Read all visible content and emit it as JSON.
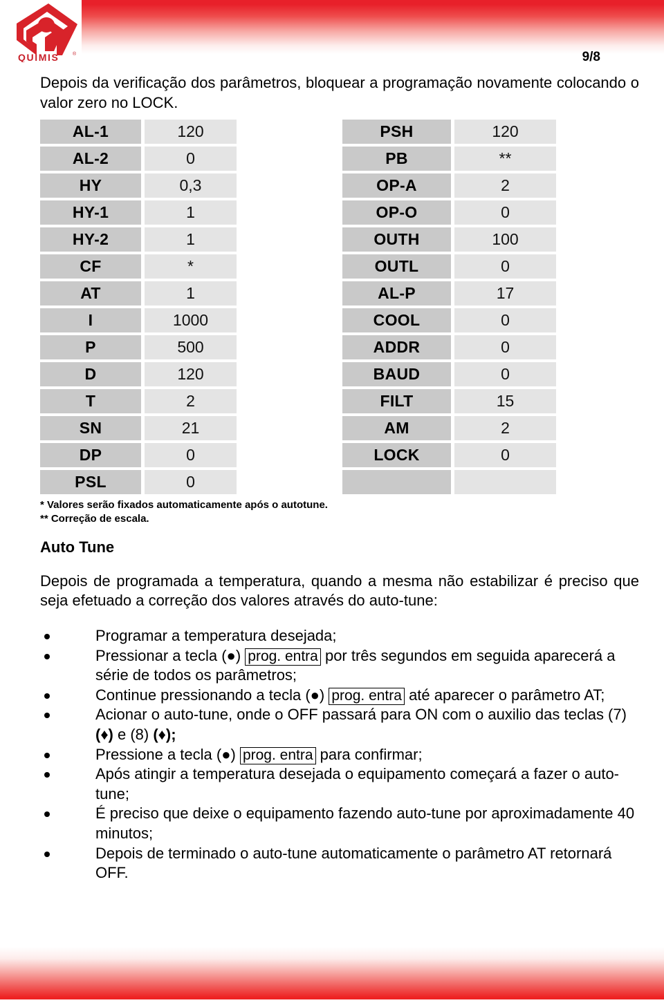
{
  "header": {
    "logo_text": "QUIMIS",
    "logo_name": "quimis-logo",
    "page_number": "9/8"
  },
  "intro": {
    "paragraph": "Depois da verificação dos parâmetros, bloquear a programação novamente colocando o valor zero no LOCK."
  },
  "tables": {
    "left": [
      {
        "label": "AL-1",
        "value": "120"
      },
      {
        "label": "AL-2",
        "value": "0"
      },
      {
        "label": "HY",
        "value": "0,3"
      },
      {
        "label": "HY-1",
        "value": "1"
      },
      {
        "label": "HY-2",
        "value": "1"
      },
      {
        "label": "CF",
        "value": "*"
      },
      {
        "label": "AT",
        "value": "1"
      },
      {
        "label": "I",
        "value": "1000"
      },
      {
        "label": "P",
        "value": "500"
      },
      {
        "label": "D",
        "value": "120"
      },
      {
        "label": "T",
        "value": "2"
      },
      {
        "label": "SN",
        "value": "21"
      },
      {
        "label": "DP",
        "value": "0"
      },
      {
        "label": "PSL",
        "value": "0"
      }
    ],
    "right": [
      {
        "label": "PSH",
        "value": "120"
      },
      {
        "label": "PB",
        "value": "**"
      },
      {
        "label": "OP-A",
        "value": "2"
      },
      {
        "label": "OP-O",
        "value": "0"
      },
      {
        "label": "OUTH",
        "value": "100"
      },
      {
        "label": "OUTL",
        "value": "0"
      },
      {
        "label": "AL-P",
        "value": "17"
      },
      {
        "label": "COOL",
        "value": "0"
      },
      {
        "label": "ADDR",
        "value": "0"
      },
      {
        "label": "BAUD",
        "value": "0"
      },
      {
        "label": "FILT",
        "value": "15"
      },
      {
        "label": "AM",
        "value": "2"
      },
      {
        "label": "LOCK",
        "value": "0"
      },
      {
        "label": "",
        "value": ""
      }
    ]
  },
  "footnotes": {
    "one": "* Valores serão fixados automaticamente após o autotune.",
    "two": "** Correção de escala."
  },
  "autotune": {
    "title": "Auto Tune",
    "paragraph": "Depois de programada a temperatura, quando a mesma não estabilizar é preciso que seja efetuado a correção dos valores através do auto-tune:",
    "bullets": [
      {
        "parts": [
          {
            "type": "text",
            "text": "Programar a temperatura desejada;"
          }
        ]
      },
      {
        "parts": [
          {
            "type": "text",
            "text": "Pressionar a tecla (●) "
          },
          {
            "type": "box",
            "text": "prog. entra"
          },
          {
            "type": "text",
            "text": " por três segundos em seguida aparecerá a série de todos os parâmetros;"
          }
        ]
      },
      {
        "parts": [
          {
            "type": "text",
            "text": "Continue pressionando a tecla (●) "
          },
          {
            "type": "box",
            "text": "prog. entra"
          },
          {
            "type": "text",
            "text": " até aparecer o parâmetro AT;"
          }
        ]
      },
      {
        "parts": [
          {
            "type": "text",
            "text": "Acionar o auto-tune, onde o OFF passará para ON com o auxilio das teclas (7) "
          },
          {
            "type": "bold",
            "text": "(♦)"
          },
          {
            "type": "text",
            "text": " e (8) "
          },
          {
            "type": "bold",
            "text": "(♦);"
          }
        ]
      },
      {
        "parts": [
          {
            "type": "text",
            "text": "Pressione a tecla (●) "
          },
          {
            "type": "box",
            "text": "prog. entra"
          },
          {
            "type": "text",
            "text": " para confirmar;"
          }
        ]
      },
      {
        "parts": [
          {
            "type": "text",
            "text": "Após atingir a temperatura desejada o equipamento começará a fazer o auto-tune;"
          }
        ]
      },
      {
        "parts": [
          {
            "type": "text",
            "text": "É preciso que deixe o equipamento fazendo auto-tune por aproximadamente 40 minutos;"
          }
        ]
      },
      {
        "parts": [
          {
            "type": "text",
            "text": "Depois de terminado o auto-tune automaticamente o parâmetro AT retornará OFF."
          }
        ]
      }
    ]
  },
  "colors": {
    "brand_red": "#e8202a",
    "label_cell": "#c9c9c9",
    "value_cell": "#e4e4e4",
    "text": "#000000"
  }
}
